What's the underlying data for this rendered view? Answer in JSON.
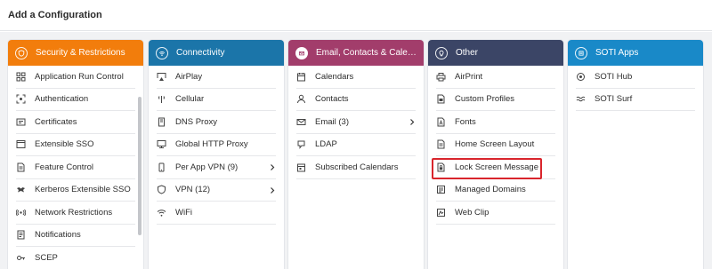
{
  "header": {
    "title": "Add a Configuration"
  },
  "colors": {
    "security": "#f27d0c",
    "connectivity": "#1b75a9",
    "email": "#a23d6b",
    "other": "#3b4566",
    "soti": "#1989c8",
    "highlight": "#d9252c"
  },
  "columns": [
    {
      "title": "Security & Restrictions",
      "items": [
        {
          "label": "Application Run Control",
          "icon": "grid-icon"
        },
        {
          "label": "Authentication",
          "icon": "scan-icon"
        },
        {
          "label": "Certificates",
          "icon": "certificate-icon"
        },
        {
          "label": "Extensible SSO",
          "icon": "window-icon"
        },
        {
          "label": "Feature Control",
          "icon": "document-icon"
        },
        {
          "label": "Kerberos Extensible SSO",
          "icon": "dog-icon"
        },
        {
          "label": "Network Restrictions",
          "icon": "network-icon"
        },
        {
          "label": "Notifications",
          "icon": "notification-icon"
        },
        {
          "label": "SCEP",
          "icon": "key-icon"
        }
      ]
    },
    {
      "title": "Connectivity",
      "items": [
        {
          "label": "AirPlay",
          "icon": "airplay-icon"
        },
        {
          "label": "Cellular",
          "icon": "cellular-icon"
        },
        {
          "label": "DNS Proxy",
          "icon": "server-icon"
        },
        {
          "label": "Global HTTP Proxy",
          "icon": "monitor-icon"
        },
        {
          "label": "Per App VPN (9)",
          "icon": "phone-icon"
        },
        {
          "label": "VPN (12)",
          "icon": "shield-icon"
        },
        {
          "label": "WiFi",
          "icon": "wifi-icon"
        }
      ]
    },
    {
      "title": "Email, Contacts & Calend…",
      "items": [
        {
          "label": "Calendars",
          "icon": "calendar-icon"
        },
        {
          "label": "Contacts",
          "icon": "person-icon"
        },
        {
          "label": "Email (3)",
          "icon": "mail-icon"
        },
        {
          "label": "LDAP",
          "icon": "ldap-icon"
        },
        {
          "label": "Subscribed Calendars",
          "icon": "calendar-subscribe-icon"
        }
      ]
    },
    {
      "title": "Other",
      "items": [
        {
          "label": "AirPrint",
          "icon": "printer-icon"
        },
        {
          "label": "Custom Profiles",
          "icon": "custom-profile-icon"
        },
        {
          "label": "Fonts",
          "icon": "font-icon"
        },
        {
          "label": "Home Screen Layout",
          "icon": "home-screen-icon"
        },
        {
          "label": "Lock Screen Message",
          "icon": "lock-screen-icon"
        },
        {
          "label": "Managed Domains",
          "icon": "domain-icon"
        },
        {
          "label": "Web Clip",
          "icon": "web-clip-icon"
        }
      ]
    },
    {
      "title": "SOTI Apps",
      "items": [
        {
          "label": "SOTI Hub",
          "icon": "hub-icon"
        },
        {
          "label": "SOTI Surf",
          "icon": "surf-icon"
        }
      ]
    }
  ]
}
